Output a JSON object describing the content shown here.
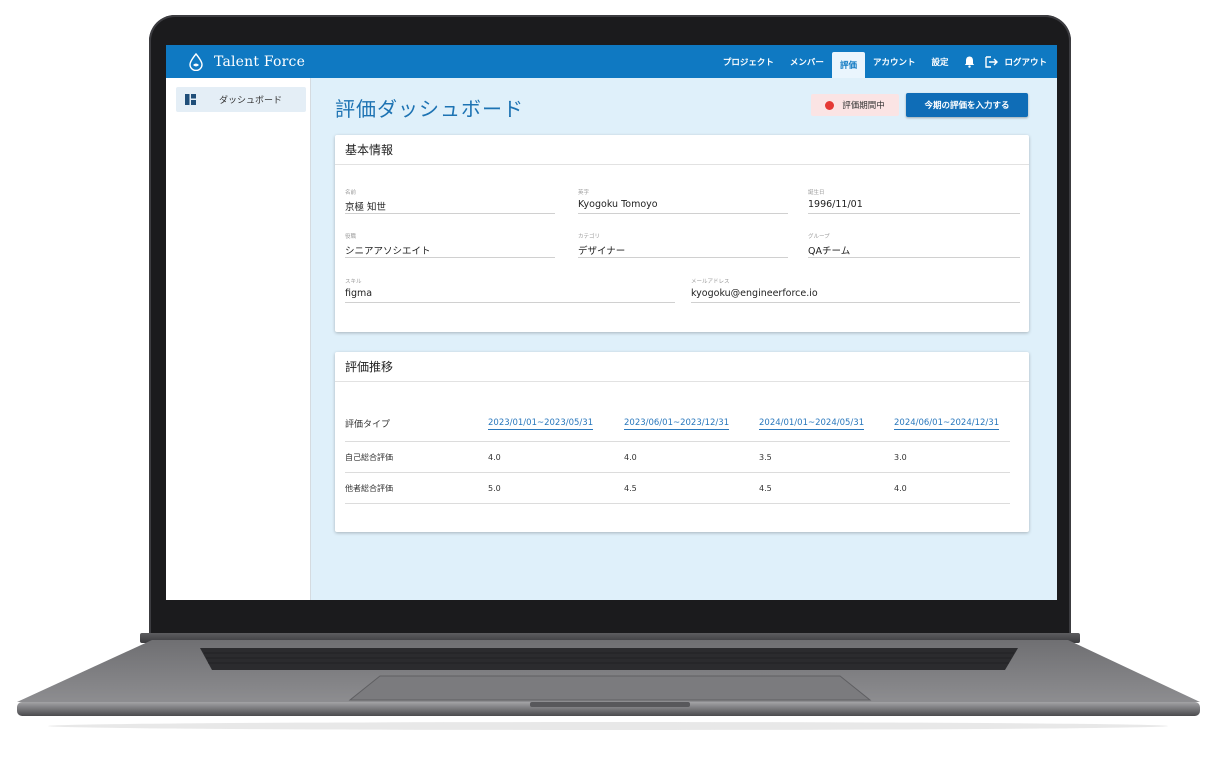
{
  "app": {
    "brand": "Talent Force"
  },
  "nav": {
    "items": [
      {
        "label": "プロジェクト",
        "active": false
      },
      {
        "label": "メンバー",
        "active": false
      },
      {
        "label": "評価",
        "active": true
      },
      {
        "label": "アカウント",
        "active": false
      },
      {
        "label": "設定",
        "active": false
      }
    ],
    "logout": "ログアウト"
  },
  "sidebar": {
    "items": [
      {
        "label": "ダッシュボード"
      }
    ]
  },
  "page": {
    "title": "評価ダッシュボード",
    "status": "評価期間中",
    "action_button": "今期の評価を入力する"
  },
  "basic_info": {
    "title": "基本情報",
    "fields": [
      {
        "label": "名前",
        "value": "京極 知世"
      },
      {
        "label": "英字",
        "value": "Kyogoku Tomoyo"
      },
      {
        "label": "誕生日",
        "value": "1996/11/01"
      },
      {
        "label": "役職",
        "value": "シニアアソシエイト"
      },
      {
        "label": "カテゴリ",
        "value": "デザイナー"
      },
      {
        "label": "グループ",
        "value": "QAチーム"
      },
      {
        "label": "スキル",
        "value": "figma"
      },
      {
        "label": "メールアドレス",
        "value": "kyogoku@engineerforce.io"
      }
    ]
  },
  "history": {
    "title": "評価推移",
    "header": "評価タイプ",
    "periods": [
      "2023/01/01~2023/05/31",
      "2023/06/01~2023/12/31",
      "2024/01/01~2024/05/31",
      "2024/06/01~2024/12/31"
    ],
    "rows": [
      {
        "label": "自己総合評価",
        "values": [
          "4.0",
          "4.0",
          "3.5",
          "3.0"
        ]
      },
      {
        "label": "他者総合評価",
        "values": [
          "5.0",
          "4.5",
          "4.5",
          "4.0"
        ]
      }
    ]
  },
  "colors": {
    "navbar": "#0f79c2",
    "title": "#1d73b3",
    "status_dot": "#e53935",
    "primary": "#0f6db7",
    "screen_bg": "#dff0fa"
  }
}
